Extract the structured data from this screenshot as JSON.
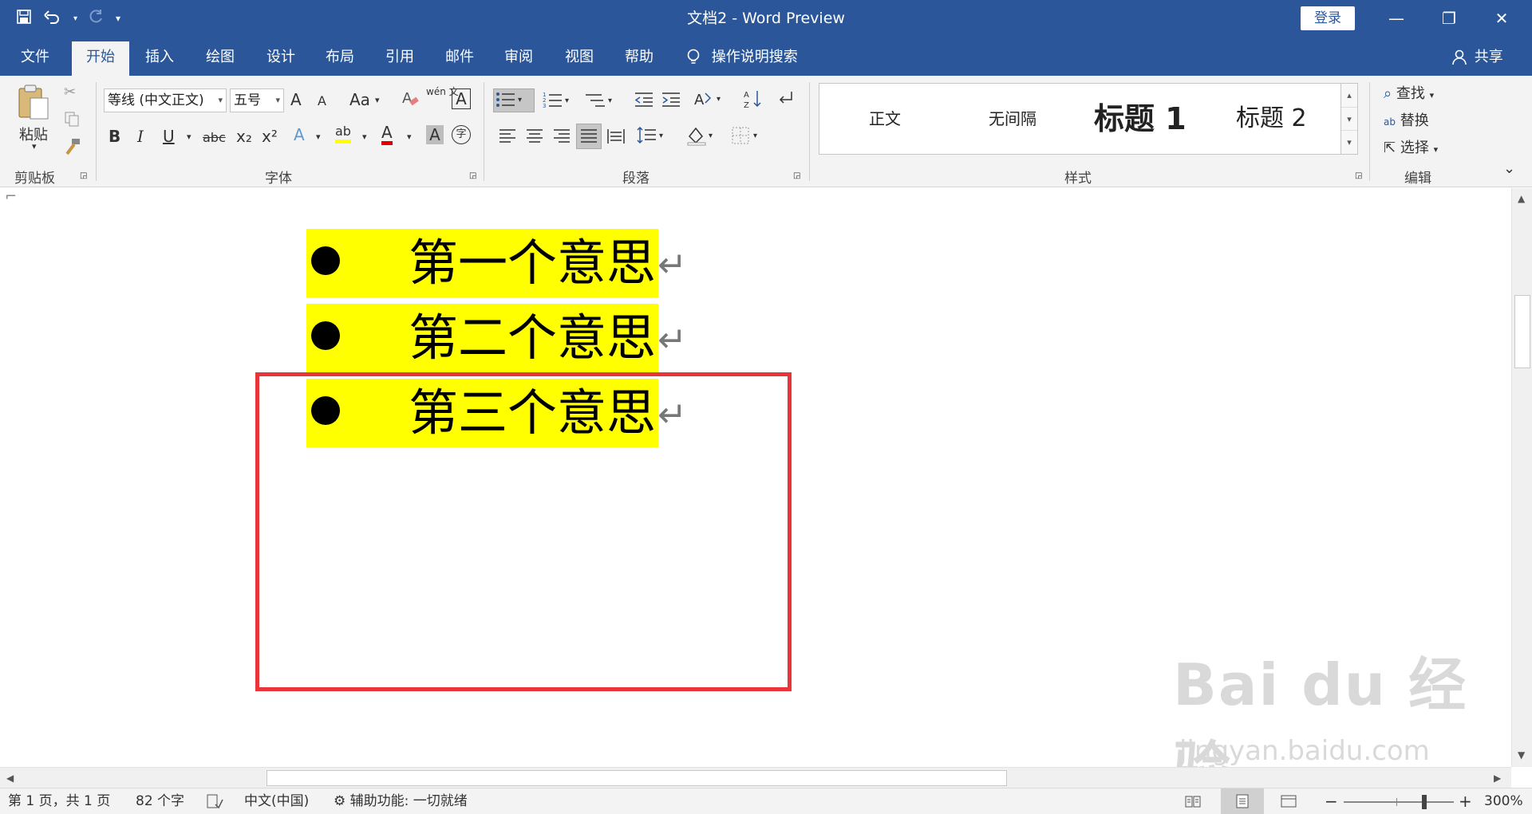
{
  "window": {
    "title": "文档2  -  Word Preview",
    "login_label": "登录",
    "minimize_glyph": "—",
    "restore_glyph": "❐",
    "close_glyph": "✕"
  },
  "qat": {
    "save_icon": "save-icon",
    "undo_icon": "undo-icon",
    "redo_icon": "redo-icon",
    "customize_icon": "customize-icon"
  },
  "tabs": [
    {
      "label": "文件"
    },
    {
      "label": "开始",
      "active": true
    },
    {
      "label": "插入"
    },
    {
      "label": "绘图"
    },
    {
      "label": "设计"
    },
    {
      "label": "布局"
    },
    {
      "label": "引用"
    },
    {
      "label": "邮件"
    },
    {
      "label": "审阅"
    },
    {
      "label": "视图"
    },
    {
      "label": "帮助"
    }
  ],
  "tellme": {
    "label": "操作说明搜索"
  },
  "share": {
    "label": "共享"
  },
  "ribbon": {
    "clipboard": {
      "label": "剪贴板",
      "paste_label": "粘贴"
    },
    "font": {
      "label": "字体",
      "font_name": "等线 (中文正文)",
      "font_size": "五号",
      "bold": "B",
      "italic": "I",
      "underline": "U",
      "strike": "abc",
      "subscript": "x₂",
      "superscript": "x²",
      "grow": "A",
      "shrink": "A",
      "case": "Aa",
      "phonetic": "wén 文",
      "char_border": "A",
      "text_effect": "A",
      "highlight": "ab",
      "font_color": "A",
      "char_shading": "A",
      "enclose": "字"
    },
    "paragraph": {
      "label": "段落"
    },
    "styles": {
      "label": "样式",
      "items": [
        {
          "label": "正文"
        },
        {
          "label": "无间隔"
        },
        {
          "label": "标题 1"
        },
        {
          "label": "标题 2"
        }
      ]
    },
    "editing": {
      "label": "编辑",
      "find": "查找",
      "replace": "替换",
      "select": "选择"
    }
  },
  "document": {
    "list_items": [
      {
        "text": "第一个意思"
      },
      {
        "text": "第二个意思"
      },
      {
        "text": "第三个意思"
      }
    ],
    "paragraph_mark": "↵",
    "highlight_color": "#ffff00",
    "annotation_box_color": "#e8343b"
  },
  "watermark": {
    "main": "Bai du 经验",
    "sub": "jingyan.baidu.com"
  },
  "status": {
    "page": "第 1 页，共 1 页",
    "word_count": "82 个字",
    "language": "中文(中国)",
    "accessibility": "辅助功能: 一切就绪",
    "zoom": "300%"
  },
  "colors": {
    "brand": "#2b579a",
    "ribbon_bg": "#f3f3f3"
  }
}
